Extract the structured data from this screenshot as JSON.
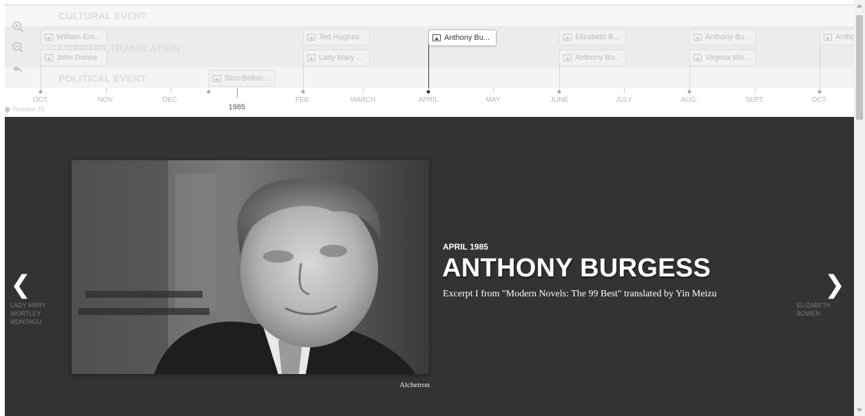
{
  "groups": [
    "CULTURAL EVENT",
    "LITERARY TRANSLATION",
    "POLITICAL EVENT"
  ],
  "zoom": {
    "zoom_in_icon": "zoom-in-icon",
    "zoom_out_icon": "zoom-out-icon",
    "back_icon": "back-arrow-icon"
  },
  "markers": [
    {
      "label": "William Em...",
      "active": false
    },
    {
      "label": "John Donne",
      "active": false
    },
    {
      "label": "Sino-British...",
      "active": false
    },
    {
      "label": "Ted Hughes",
      "active": false
    },
    {
      "label": "Lady Mary ...",
      "active": false
    },
    {
      "label": "Anthony Bu...",
      "active": true
    },
    {
      "label": "Elizabeth B...",
      "active": false
    },
    {
      "label": "Anthony Bu...",
      "active": false
    },
    {
      "label": "Anthony Bu...",
      "active": false
    },
    {
      "label": "Virginia Wo...",
      "active": false
    },
    {
      "label": "Antho",
      "active": false
    }
  ],
  "axis": {
    "months": [
      "OCT.",
      "NOV.",
      "DEC.",
      "FEB.",
      "MARCH",
      "APRIL",
      "MAY",
      "JUNE",
      "JULY",
      "AUG.",
      "SEPT.",
      "OCT."
    ],
    "year": "1985"
  },
  "credit": "Timeline JS",
  "slide": {
    "date": "APRIL 1985",
    "headline": "ANTHONY BURGESS",
    "text": "Excerpt I from \"Modern Novels: The 99 Best\" translated by Yin Meizu",
    "media_credit": "Alchetron",
    "prev": {
      "title": "LADY MARY WORTLEY MONTAGU"
    },
    "next": {
      "title": "ELIZABETH BOWEN"
    }
  },
  "colors": {
    "slide_bg": "#333333",
    "accent": "#ffffff"
  }
}
